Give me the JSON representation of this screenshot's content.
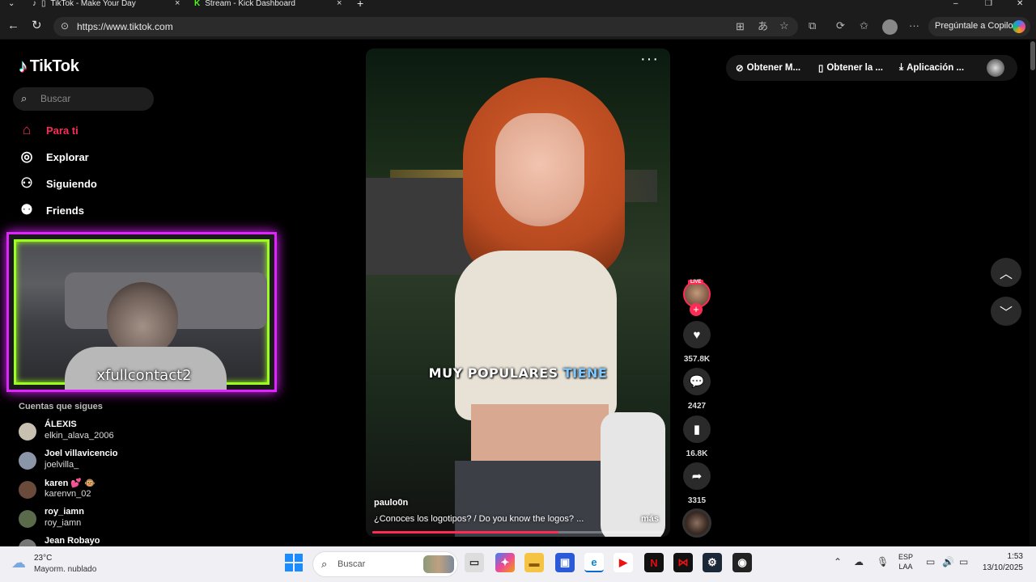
{
  "browser": {
    "tabs": [
      {
        "title": "TikTok - Make Your Day"
      },
      {
        "title": "Stream - Kick Dashboard"
      }
    ],
    "url": "https://www.tiktok.com",
    "copilot_label": "Pregúntale a Copilot"
  },
  "sidebar": {
    "logo": "TikTok",
    "search_placeholder": "Buscar",
    "nav": [
      {
        "label": "Para ti",
        "icon": "home-icon"
      },
      {
        "label": "Explorar",
        "icon": "compass-icon"
      },
      {
        "label": "Siguiendo",
        "icon": "following-icon"
      },
      {
        "label": "Friends",
        "icon": "friends-icon"
      }
    ],
    "following_title": "Cuentas que sigues",
    "accounts": [
      {
        "name": "ÁLEXIS",
        "username": "elkin_alava_2006"
      },
      {
        "name": "Joel villavicencio",
        "username": "joelvilla_"
      },
      {
        "name": "karen 💕 🐵",
        "username": "karenvn_02"
      },
      {
        "name": "roy_iamn",
        "username": "roy_iamn"
      },
      {
        "name": "Jean Robayo",
        "username": ""
      }
    ]
  },
  "webcam_overlay": {
    "handle": "xfullcontact2"
  },
  "video": {
    "caption_main": "MUY POPULARES ",
    "caption_highlight": "TIENE",
    "author": "paulo0n",
    "description": "¿Conoces los logotipos? / Do you know the logos? ...",
    "more": "más",
    "progress": 0.64,
    "live_badge": "LIVE",
    "stats": {
      "likes": "357.8K",
      "comments": "2427",
      "saves": "16.8K",
      "shares": "3315"
    }
  },
  "top_actions": [
    {
      "label": "Obtener M...",
      "icon": "coin-icon"
    },
    {
      "label": "Obtener la ...",
      "icon": "phone-icon"
    },
    {
      "label": "Aplicación ...",
      "icon": "download-icon"
    }
  ],
  "taskbar": {
    "weather_temp": "23°C",
    "weather_cond": "Mayorm. nublado",
    "search_placeholder": "Buscar",
    "lang_line1": "ESP",
    "lang_line2": "LAA",
    "time": "1:53",
    "date": "13/10/2025"
  },
  "colors": {
    "accent": "#fe2c55",
    "cam_outer": "#e024ff",
    "cam_inner": "#9cff1e"
  }
}
